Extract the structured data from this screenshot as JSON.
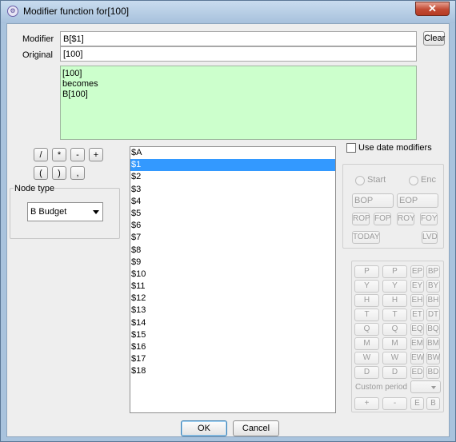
{
  "window": {
    "title": "Modifier function for[100]",
    "close_glyph": "✕",
    "accent": "#3399ff",
    "preview_bg": "#ccffcc"
  },
  "form": {
    "modifier_label": "Modifier",
    "modifier_value": "B[$1]",
    "original_label": "Original",
    "original_value": "[100]",
    "clear_label": "Clear"
  },
  "preview": [
    "[100]",
    "becomes",
    "B[100]"
  ],
  "operators": {
    "row1": [
      "/",
      "*",
      "-",
      "+"
    ],
    "row2": [
      "(",
      ")",
      ","
    ]
  },
  "node_type": {
    "legend": "Node type",
    "selected": "B Budget"
  },
  "variables": [
    "$A",
    "$1",
    "$2",
    "$3",
    "$4",
    "$5",
    "$6",
    "$7",
    "$8",
    "$9",
    "$10",
    "$11",
    "$12",
    "$13",
    "$14",
    "$15",
    "$16",
    "$17",
    "$18"
  ],
  "selected_variable": "$1",
  "date": {
    "use_date_modifiers": "Use date modifiers",
    "start": "Start",
    "end": "Enc",
    "bop": "BOP",
    "eop": "EOP",
    "small": [
      "ROP",
      "FOP",
      "ROY",
      "FOY"
    ],
    "today": "TODAY",
    "lvd": "LVD"
  },
  "period_grid": {
    "rows": [
      [
        "P",
        "P",
        "EP",
        "BP"
      ],
      [
        "Y",
        "Y",
        "EY",
        "BY"
      ],
      [
        "H",
        "H",
        "EH",
        "BH"
      ],
      [
        "T",
        "T",
        "ET",
        "DT"
      ],
      [
        "Q",
        "Q",
        "EQ",
        "BQ"
      ],
      [
        "M",
        "M",
        "EM",
        "BM"
      ],
      [
        "W",
        "W",
        "EW",
        "BW"
      ],
      [
        "D",
        "D",
        "ED",
        "BD"
      ]
    ],
    "custom_period": "Custom period",
    "bottom": [
      "+",
      "-",
      "E",
      "B"
    ]
  },
  "dialog": {
    "ok": "OK",
    "cancel": "Cancel"
  }
}
